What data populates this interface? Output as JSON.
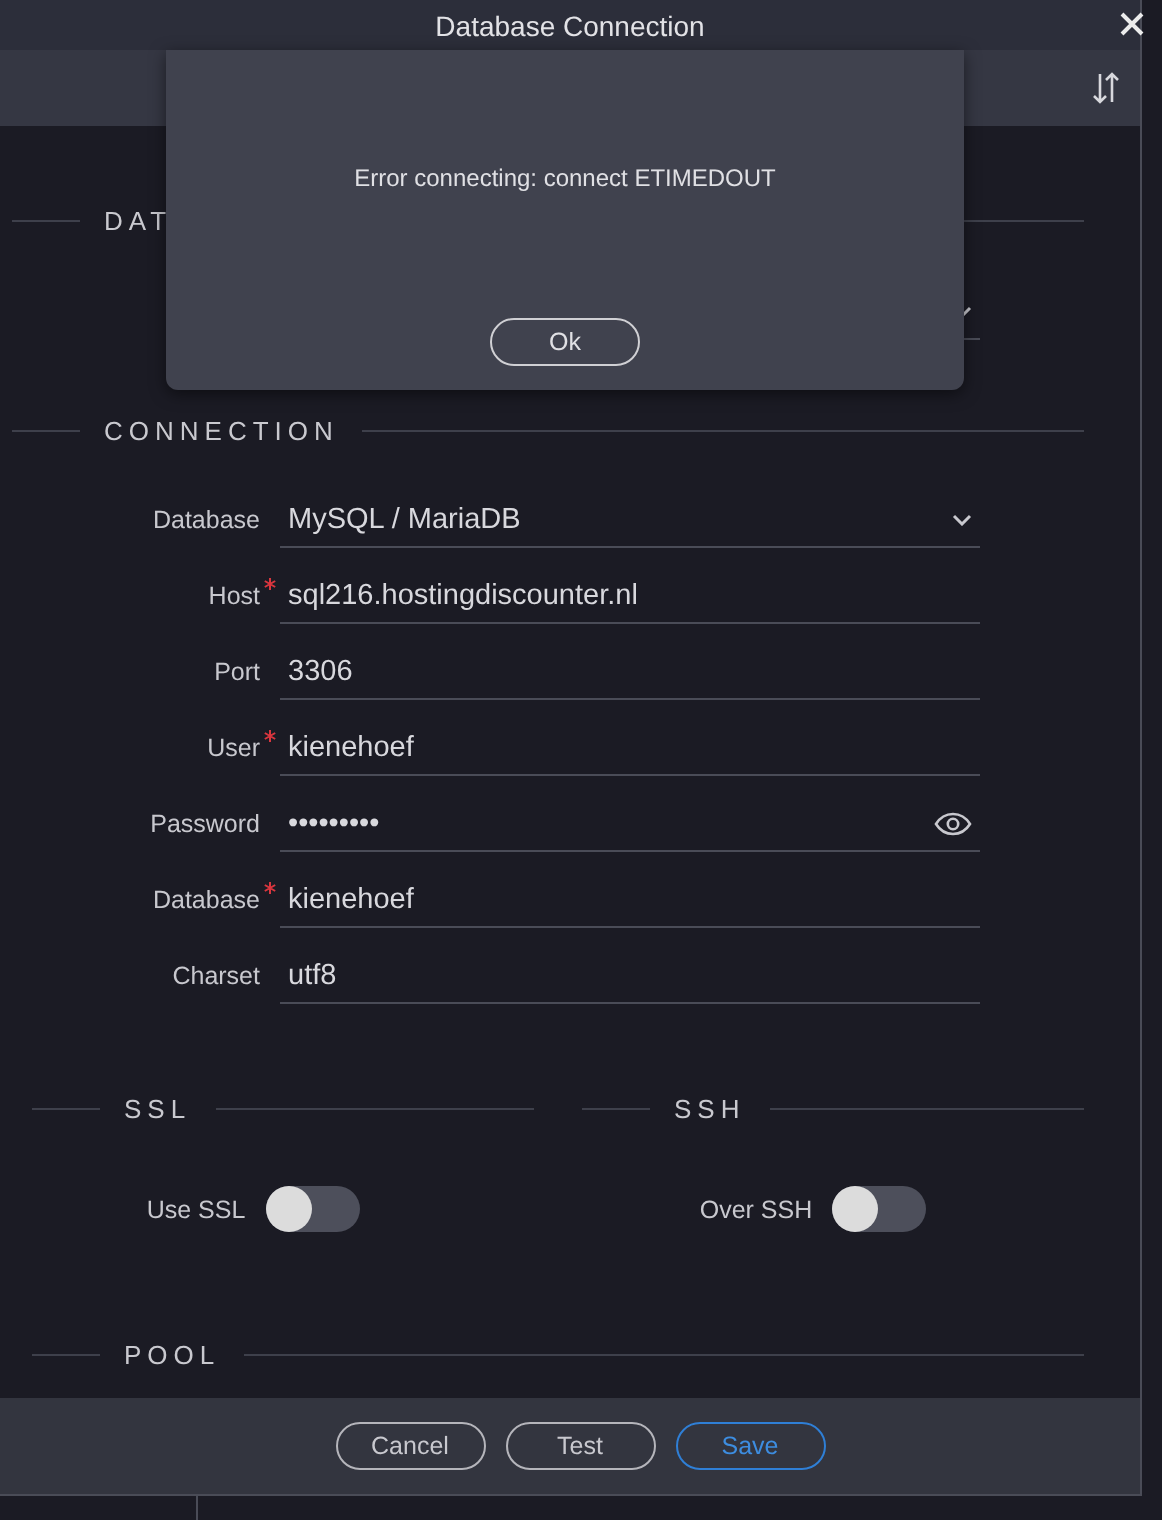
{
  "window": {
    "title": "Database Connection"
  },
  "hidden_section": {
    "title": "DAT"
  },
  "connection": {
    "title": "CONNECTION",
    "fields": [
      {
        "kind": "select",
        "label": "Database",
        "required": false,
        "value": "MySQL / MariaDB"
      },
      {
        "kind": "text",
        "label": "Host",
        "required": true,
        "value": "sql216.hostingdiscounter.nl"
      },
      {
        "kind": "text",
        "label": "Port",
        "required": false,
        "value": "3306"
      },
      {
        "kind": "text",
        "label": "User",
        "required": true,
        "value": "kienehoef"
      },
      {
        "kind": "password",
        "label": "Password",
        "required": false,
        "value": "•••••••••"
      },
      {
        "kind": "text",
        "label": "Database",
        "required": true,
        "value": "kienehoef"
      },
      {
        "kind": "text",
        "label": "Charset",
        "required": false,
        "value": "utf8"
      }
    ]
  },
  "ssl": {
    "title": "SSL",
    "label": "Use SSL",
    "on": false
  },
  "ssh": {
    "title": "SSH",
    "label": "Over SSH",
    "on": false
  },
  "pool": {
    "title": "POOL"
  },
  "buttons": [
    {
      "label": "Cancel",
      "kind": "default"
    },
    {
      "label": "Test",
      "kind": "default"
    },
    {
      "label": "Save",
      "kind": "primary"
    }
  ],
  "alert": {
    "message": "Error connecting: connect ETIMEDOUT",
    "button": "Ok"
  }
}
